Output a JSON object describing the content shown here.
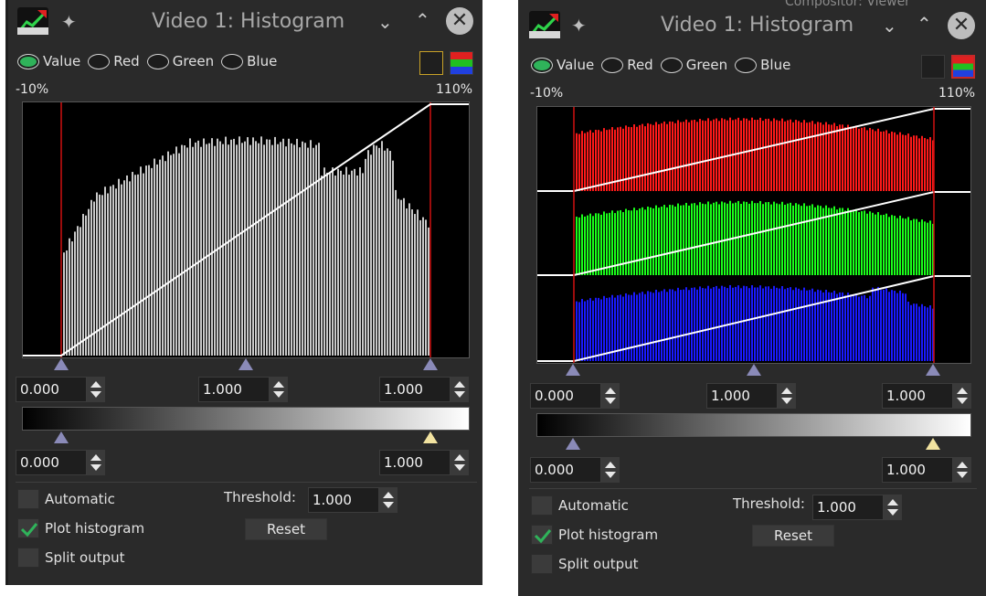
{
  "window_left": {
    "title": "Video 1: Histogram",
    "radios": [
      {
        "label": "Value",
        "selected": true
      },
      {
        "label": "Red",
        "selected": false
      },
      {
        "label": "Green",
        "selected": false
      },
      {
        "label": "Blue",
        "selected": false
      }
    ],
    "display_mode": "value",
    "range_min_label": "-10%",
    "range_max_label": "110%",
    "input_low": "0.000",
    "input_gamma": "1.000",
    "input_high": "1.000",
    "output_low": "0.000",
    "output_high": "1.000",
    "automatic_label": "Automatic",
    "automatic_checked": false,
    "plot_histogram_label": "Plot histogram",
    "plot_histogram_checked": true,
    "split_output_label": "Split output",
    "split_output_checked": false,
    "threshold_label": "Threshold:",
    "threshold_value": "1.000",
    "reset_label": "Reset"
  },
  "window_right": {
    "title": "Video 1: Histogram",
    "background_title": "Compositor: Viewer",
    "radios": [
      {
        "label": "Value",
        "selected": true
      },
      {
        "label": "Red",
        "selected": false
      },
      {
        "label": "Green",
        "selected": false
      },
      {
        "label": "Blue",
        "selected": false
      }
    ],
    "display_mode": "rgb",
    "range_min_label": "-10%",
    "range_max_label": "110%",
    "input_low": "0.000",
    "input_gamma": "1.000",
    "input_high": "1.000",
    "output_low": "0.000",
    "output_high": "1.000",
    "automatic_label": "Automatic",
    "automatic_checked": false,
    "plot_histogram_label": "Plot histogram",
    "plot_histogram_checked": true,
    "split_output_label": "Split output",
    "split_output_checked": false,
    "threshold_label": "Threshold:",
    "threshold_value": "1.000",
    "reset_label": "Reset"
  },
  "colors": {
    "window_bg": "#2a2a2a",
    "plot_bg": "#000000",
    "value_hist": "#c8c8c8",
    "red_hist": "#ff1a1a",
    "green_hist": "#1aff1a",
    "blue_hist": "#1a1aff",
    "curve": "#ffffff",
    "range_line": "#d01010",
    "check_green": "#2fb35a"
  },
  "icons": [
    "app-icon",
    "pin-icon",
    "minimize-icon",
    "maximize-icon",
    "close-icon",
    "spin-up-icon",
    "spin-down-icon",
    "checkmark-icon"
  ]
}
